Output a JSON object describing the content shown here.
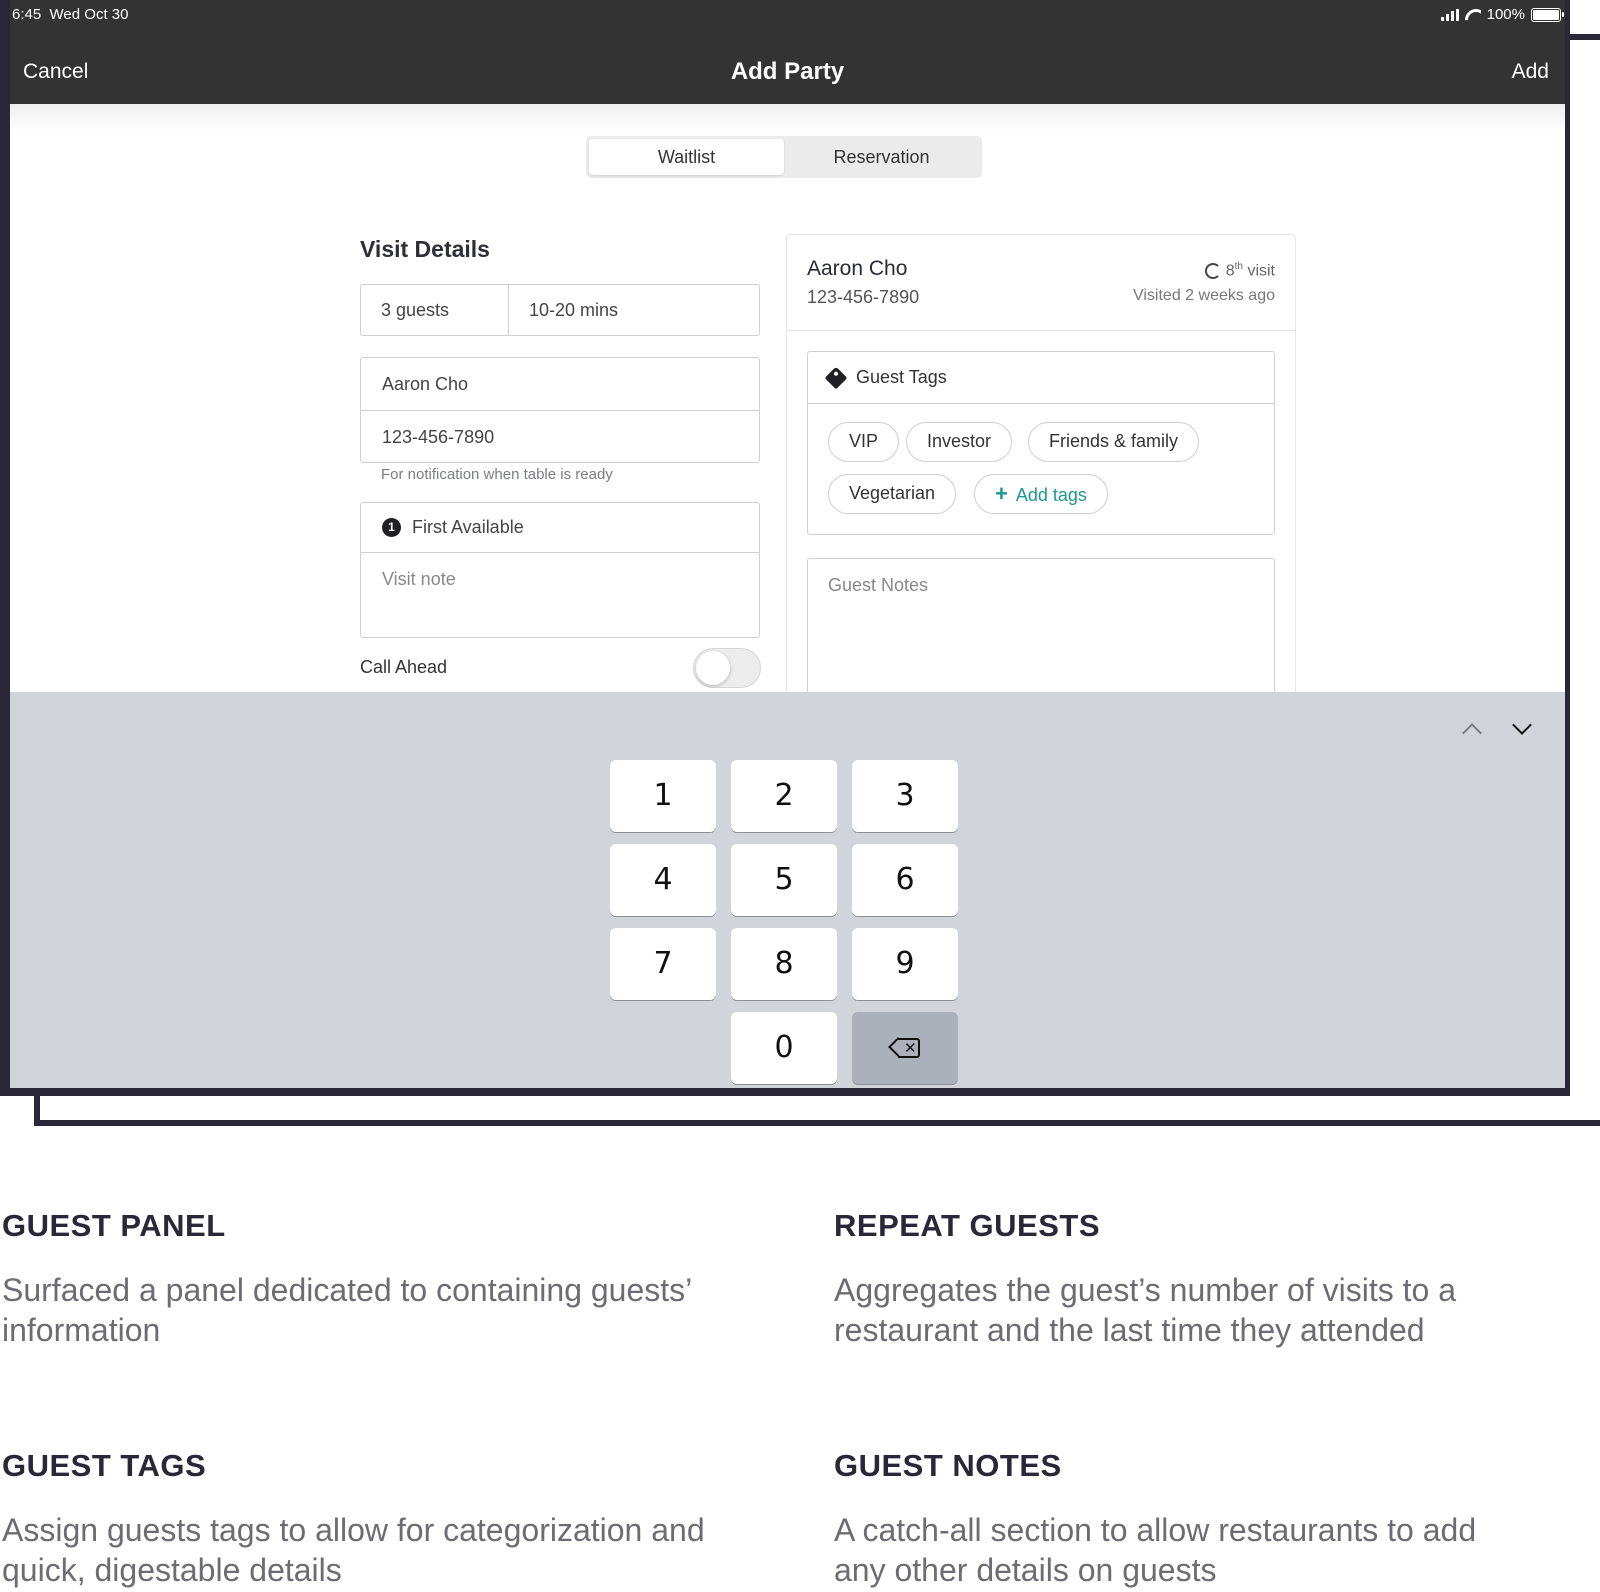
{
  "status_bar": {
    "time": "6:45",
    "date": "Wed Oct 30",
    "battery": "100%"
  },
  "nav": {
    "cancel": "Cancel",
    "title": "Add Party",
    "add": "Add"
  },
  "segment": {
    "options": [
      "Waitlist",
      "Reservation"
    ],
    "selected": "Waitlist"
  },
  "visit_details": {
    "title": "Visit Details",
    "guests": "3 guests",
    "wait": "10-20 mins",
    "name": "Aaron Cho",
    "phone": "123-456-7890",
    "phone_hint": "For notification when table is ready",
    "seating_badge": "1",
    "seating": "First Available",
    "visit_note_placeholder": "Visit note",
    "call_ahead": "Call Ahead",
    "call_ahead_on": false
  },
  "guest_panel": {
    "name": "Aaron Cho",
    "phone": "123-456-7890",
    "visit_number": "8",
    "visit_suffix": "th",
    "visit_label": "visit",
    "last_visit": "Visited 2 weeks ago",
    "tags_title": "Guest Tags",
    "tags": [
      "VIP",
      "Investor",
      "Friends & family",
      "Vegetarian"
    ],
    "add_tags": "Add tags",
    "notes_placeholder": "Guest Notes"
  },
  "keypad": {
    "keys": [
      "1",
      "2",
      "3",
      "4",
      "5",
      "6",
      "7",
      "8",
      "9",
      "0"
    ]
  },
  "captions": [
    {
      "title": "GUEST PANEL",
      "text": "Surfaced a panel dedicated to containing guests’ information"
    },
    {
      "title": "REPEAT GUESTS",
      "text": "Aggregates the guest’s number of visits to a restaurant and the last time they attended"
    },
    {
      "title": "GUEST TAGS",
      "text": "Assign guests tags to allow for categorization and quick, digestable details"
    },
    {
      "title": "GUEST NOTES",
      "text": "A catch-all section to allow restaurants to add any other details on guests"
    }
  ],
  "colors": {
    "device_frame": "#2a2838",
    "nav_bar": "#333333",
    "accent": "#1a9890",
    "keyboard": "#d1d4db"
  }
}
